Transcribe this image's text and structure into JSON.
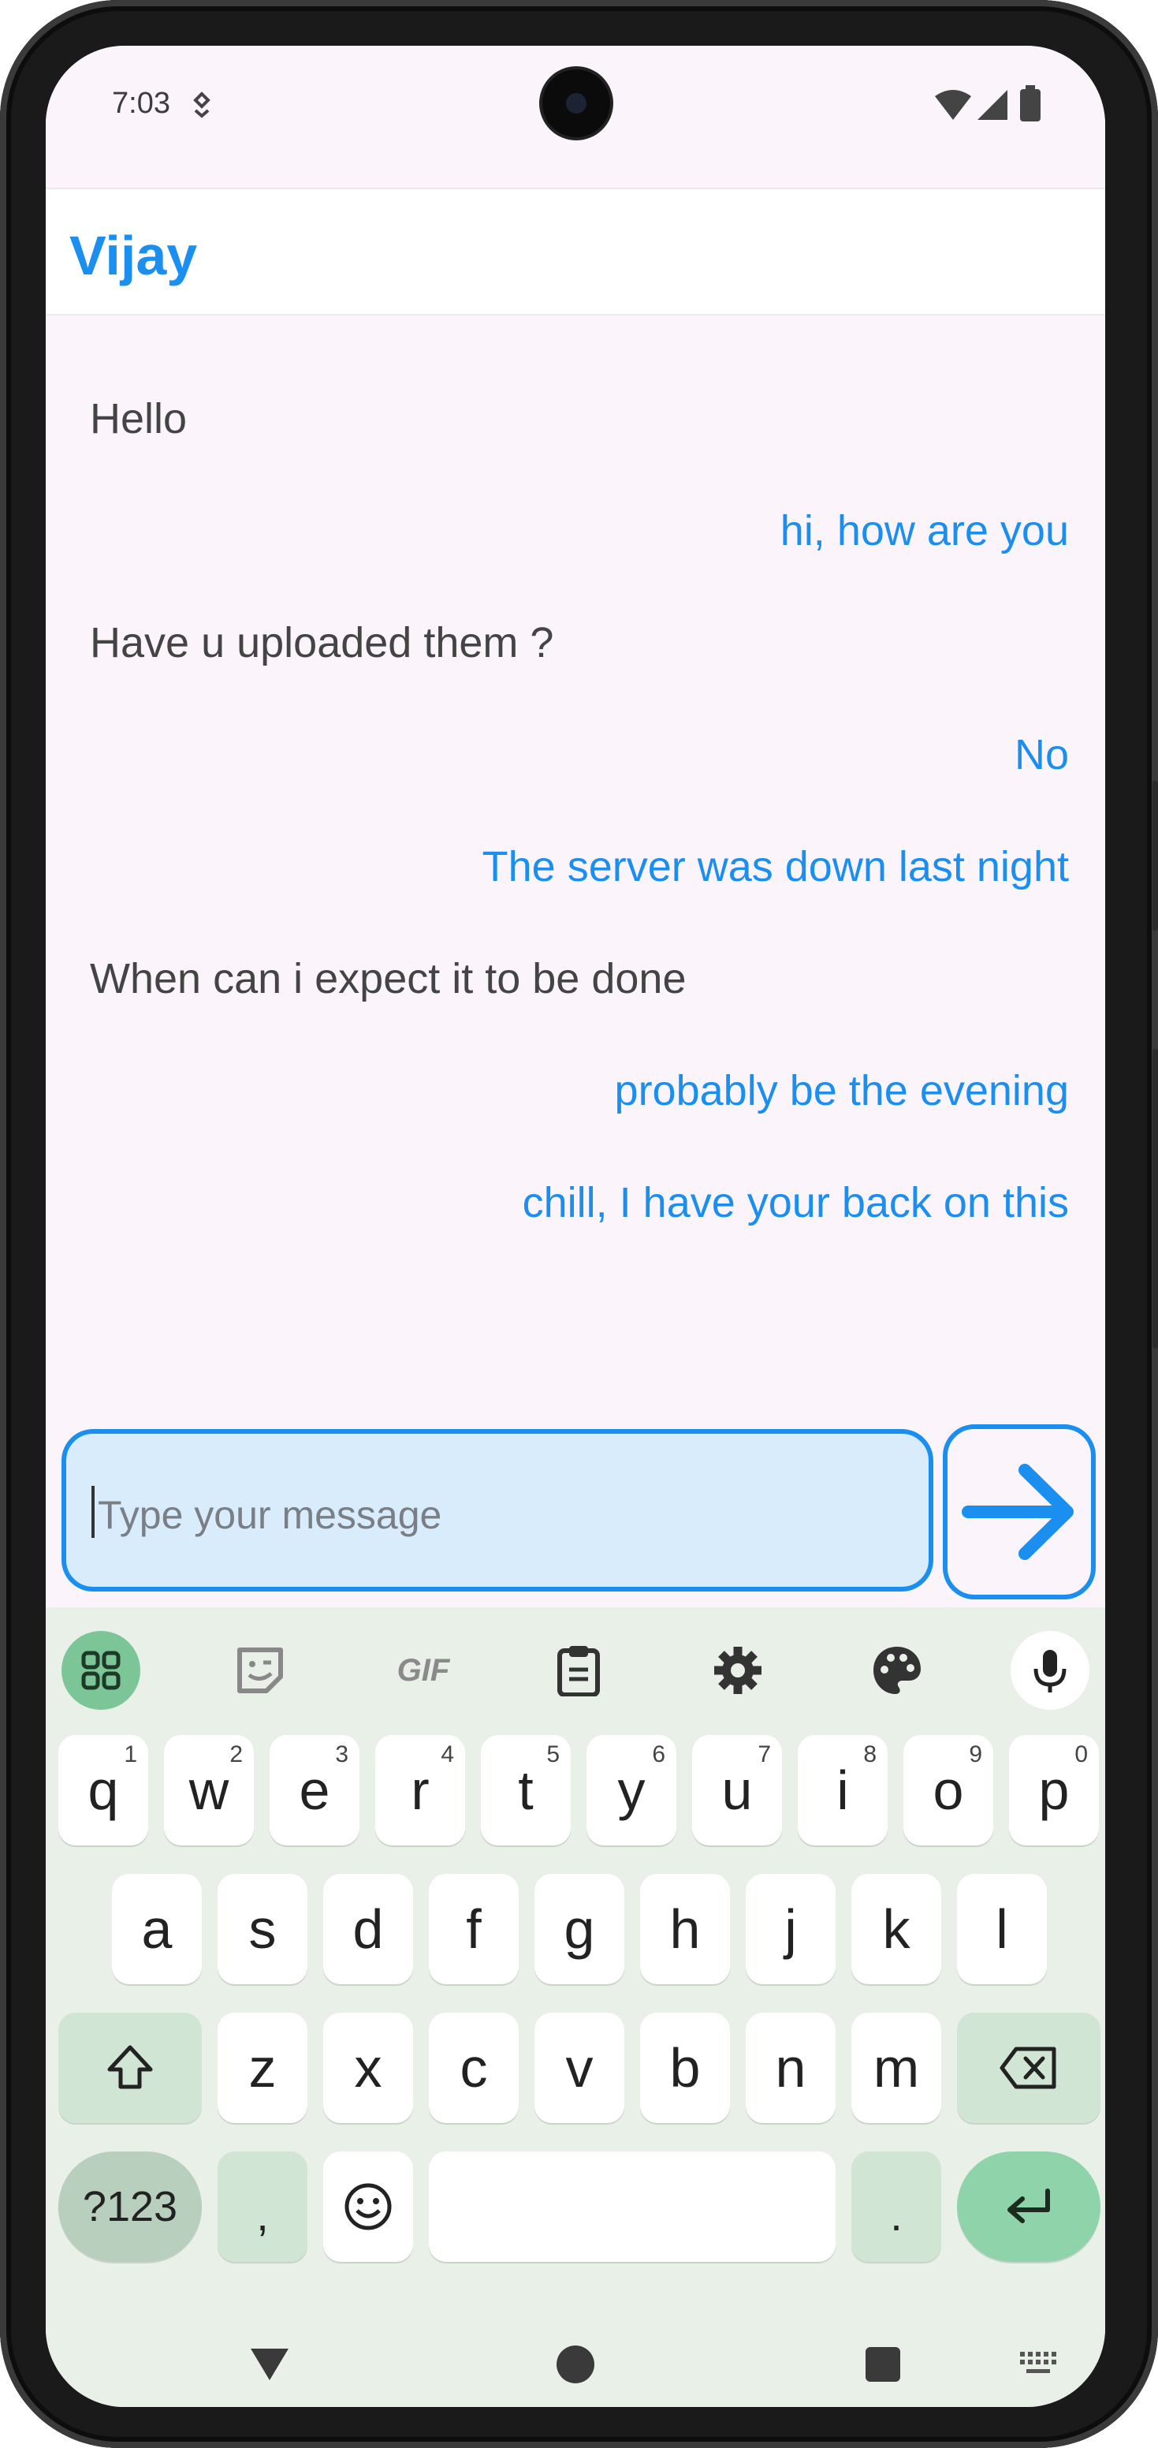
{
  "status_bar": {
    "time": "7:03"
  },
  "app_bar": {
    "title": "Vijay"
  },
  "messages": [
    {
      "text": "Hello",
      "direction": "incoming"
    },
    {
      "text": "hi, how are you",
      "direction": "outgoing"
    },
    {
      "text": "Have u uploaded them ?",
      "direction": "incoming"
    },
    {
      "text": "No",
      "direction": "outgoing"
    },
    {
      "text": "The server was down last night",
      "direction": "outgoing"
    },
    {
      "text": "When can i expect it to be done",
      "direction": "incoming"
    },
    {
      "text": "probably be the evening",
      "direction": "outgoing"
    },
    {
      "text": "chill, I have your back on this",
      "direction": "outgoing"
    }
  ],
  "composer": {
    "placeholder": "Type your message",
    "value": ""
  },
  "keyboard": {
    "toolbar": [
      "apps-grid-icon",
      "sticker-icon",
      "gif-icon",
      "clipboard-icon",
      "settings-icon",
      "palette-icon",
      "mic-icon"
    ],
    "gif_label": "GIF",
    "row1": [
      {
        "key": "q",
        "hint": "1"
      },
      {
        "key": "w",
        "hint": "2"
      },
      {
        "key": "e",
        "hint": "3"
      },
      {
        "key": "r",
        "hint": "4"
      },
      {
        "key": "t",
        "hint": "5"
      },
      {
        "key": "y",
        "hint": "6"
      },
      {
        "key": "u",
        "hint": "7"
      },
      {
        "key": "i",
        "hint": "8"
      },
      {
        "key": "o",
        "hint": "9"
      },
      {
        "key": "p",
        "hint": "0"
      }
    ],
    "row2": [
      "a",
      "s",
      "d",
      "f",
      "g",
      "h",
      "j",
      "k",
      "l"
    ],
    "row3": [
      "z",
      "x",
      "c",
      "v",
      "b",
      "n",
      "m"
    ],
    "symbols_label": "?123",
    "comma": ",",
    "period": "."
  },
  "colors": {
    "accent": "#1a8ff0",
    "background": "#fcf4fb",
    "incoming_text": "#444444",
    "input_fill": "#d8ecfc",
    "keyboard_bg": "#e9f0e8"
  }
}
